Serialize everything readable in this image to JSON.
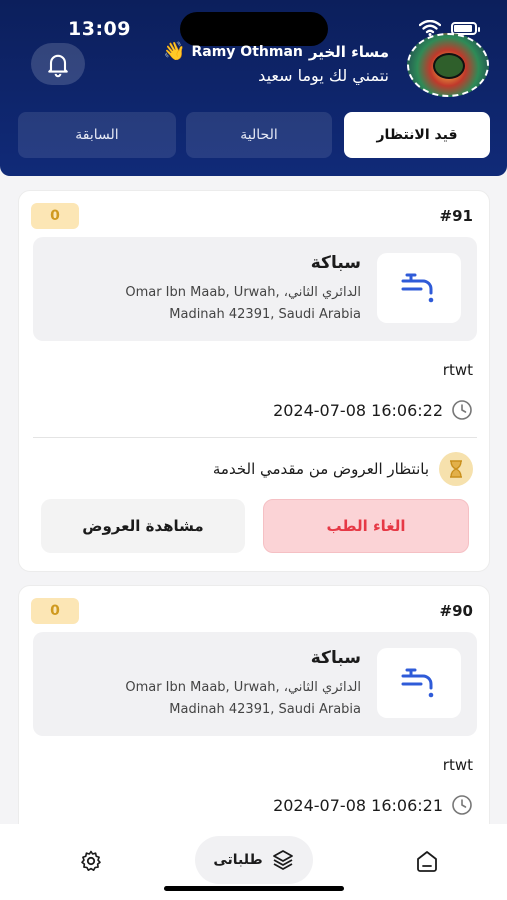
{
  "status_bar": {
    "time": "13:09"
  },
  "header": {
    "greeting": "مساء الخير",
    "user_name": "Ramy Othman",
    "wave_emoji": "👋",
    "wish": "نتمني لك يوما سعيد"
  },
  "tabs": [
    {
      "label": "قيد الانتظار",
      "active": true
    },
    {
      "label": "الحالية",
      "active": false
    },
    {
      "label": "السابقة",
      "active": false
    }
  ],
  "orders": [
    {
      "number": "#91",
      "badge": "0",
      "service_name": "سباكة",
      "address_line1": "Omar Ibn Maab, Urwah, ،الدائري الثاني",
      "address_line2": "Madinah 42391, Saudi Arabia",
      "note": "rtwt",
      "datetime": "2024-07-08 16:06:22",
      "status_text": "بانتظار العروض من مقدمي الخدمة",
      "cancel_label": "الغاء الطب",
      "offers_label": "مشاهدة العروض"
    },
    {
      "number": "#90",
      "badge": "0",
      "service_name": "سباكة",
      "address_line1": "Omar Ibn Maab, Urwah, ،الدائري الثاني",
      "address_line2": "Madinah 42391, Saudi Arabia",
      "note": "rtwt",
      "datetime": "2024-07-08 16:06:21"
    }
  ],
  "bottom_nav": {
    "requests_label": "طلباتى"
  },
  "colors": {
    "header": "#0c1f5c",
    "cancel_bg": "#fbd3d6",
    "cancel_text": "#e63946",
    "badge_bg": "#fce6b5",
    "icon_blue": "#2f5bd8"
  }
}
